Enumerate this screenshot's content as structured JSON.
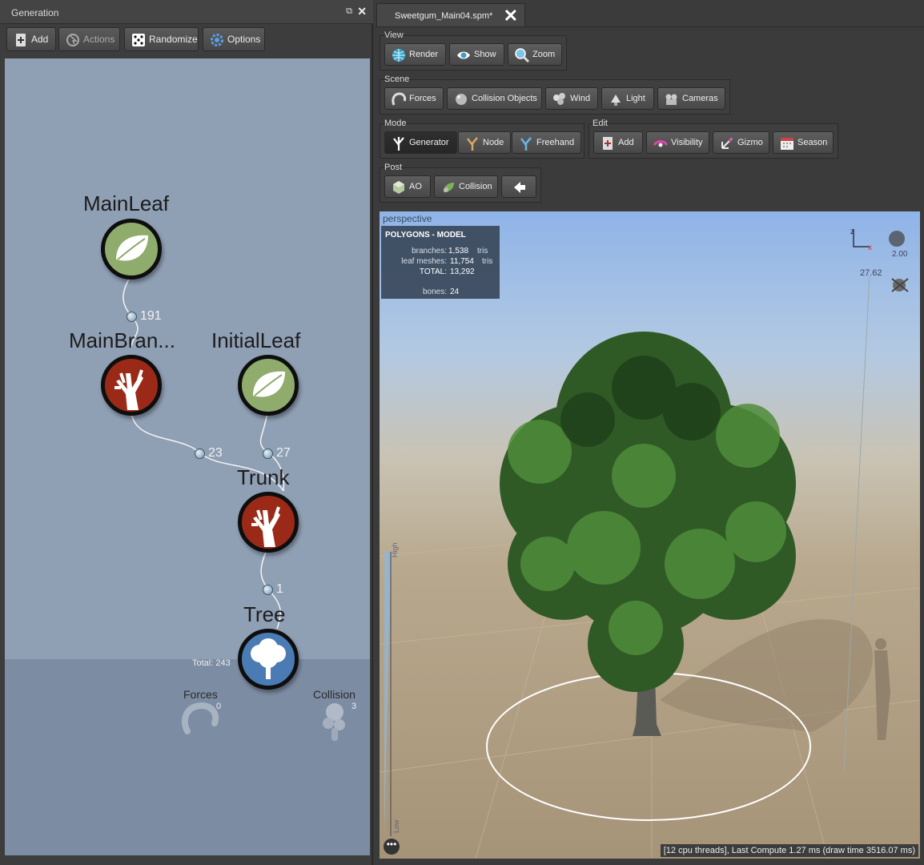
{
  "left_panel": {
    "title": "Generation",
    "toolbar": {
      "add": "Add",
      "actions": "Actions",
      "randomize": "Randomize",
      "options": "Options"
    },
    "nodes": {
      "main_leaf": "MainLeaf",
      "main_branch": "MainBran...",
      "initial_leaf": "InitialLeaf",
      "trunk": "Trunk",
      "tree": "Tree"
    },
    "counts": {
      "main_leaf": "191",
      "main_branch": "23",
      "initial_leaf": "27",
      "trunk": "1"
    },
    "total": "Total: 243",
    "forces": {
      "label": "Forces",
      "count": "0"
    },
    "collision": {
      "label": "Collision",
      "count": "3"
    }
  },
  "document_tab": {
    "title": "Sweetgum_Main04.spm*"
  },
  "groups": {
    "view": {
      "label": "View",
      "buttons": [
        "Render",
        "Show",
        "Zoom"
      ]
    },
    "scene": {
      "label": "Scene",
      "buttons": [
        "Forces",
        "Collision Objects",
        "Wind",
        "Light",
        "Cameras"
      ]
    },
    "mode": {
      "label": "Mode",
      "buttons": [
        "Generator",
        "Node",
        "Freehand"
      ]
    },
    "edit": {
      "label": "Edit",
      "buttons": [
        "Add",
        "Visibility",
        "Gizmo",
        "Season"
      ]
    },
    "post": {
      "label": "Post",
      "buttons": [
        "AO",
        "Collision"
      ]
    }
  },
  "viewport": {
    "camera": "perspective",
    "stats": {
      "header": "POLYGONS - MODEL",
      "branches_label": "branches:",
      "branches_value": "1,538",
      "branches_unit": "tris",
      "leaf_label": "leaf meshes:",
      "leaf_value": "11,754",
      "leaf_unit": "tris",
      "total_label": "TOTAL:",
      "total_value": "13,292",
      "bones_label": "bones:",
      "bones_value": "24"
    },
    "axis_z": "z",
    "axis_x": "x",
    "scale_value": "2.00",
    "height_value": "27.62",
    "lod_high": "High",
    "lod_low": "Low",
    "status": "[12 cpu threads], Last Compute 1.27 ms (draw time 3516.07 ms)",
    "more": "•••"
  },
  "colors": {
    "leaf_node": "#8fac6d",
    "branch_node": "#9a2a17",
    "tree_node": "#4a7bb3",
    "graph_background": "#8f9fb4"
  }
}
